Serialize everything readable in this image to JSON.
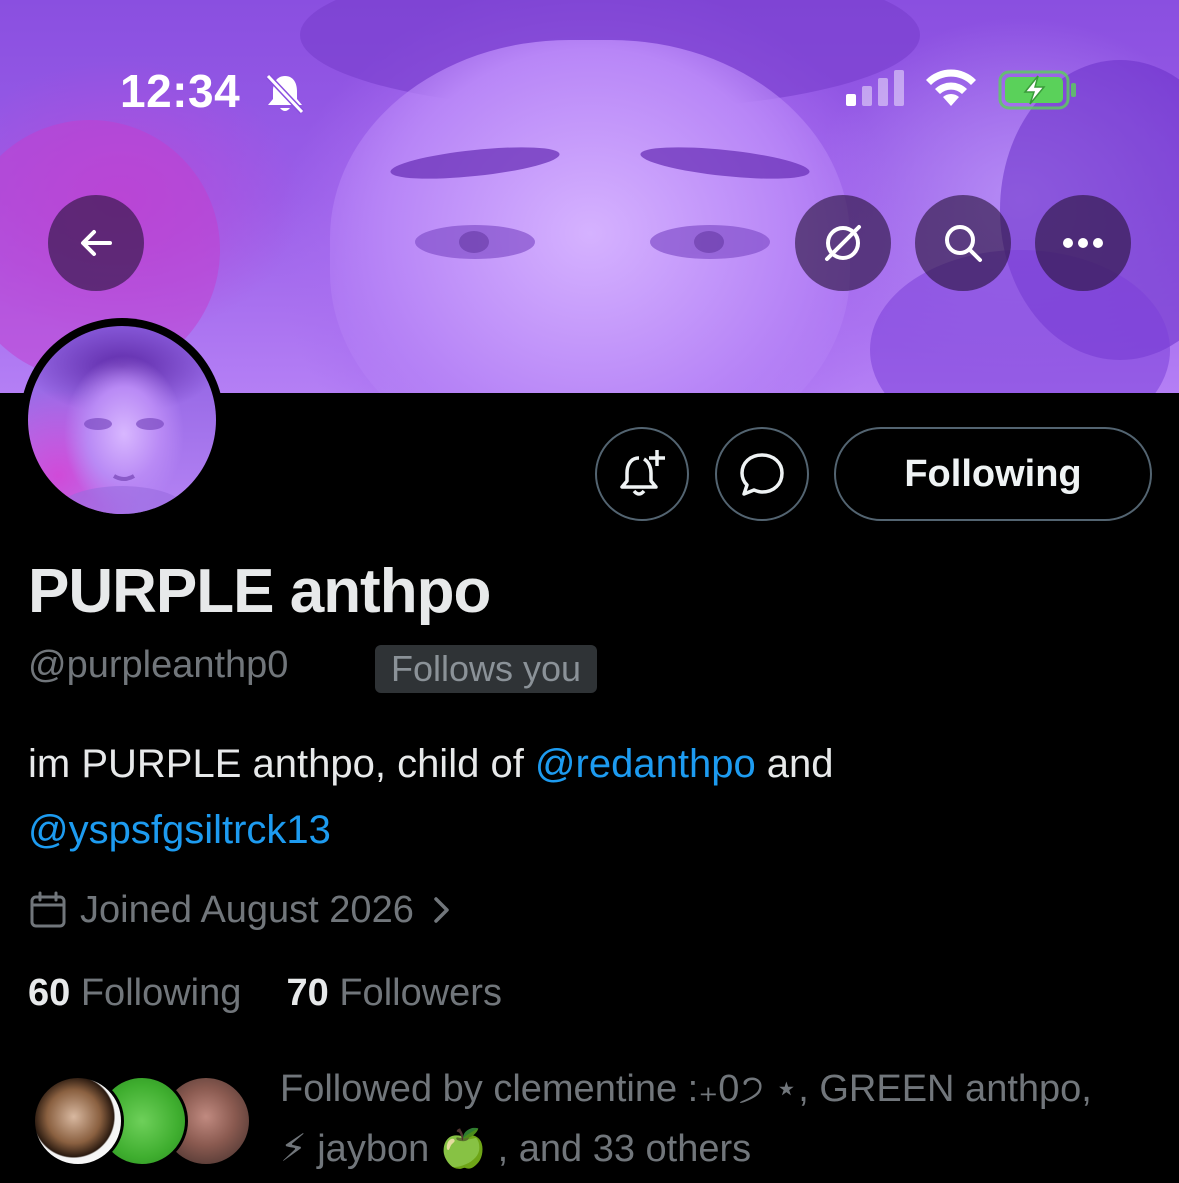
{
  "status_bar": {
    "time": "12:34"
  },
  "icons": {
    "mute": "bell-slash-icon",
    "signal": "cellular-signal-icon",
    "wifi": "wifi-icon",
    "battery": "battery-charging-icon",
    "back": "arrow-left-icon",
    "grok": "grok-icon",
    "search": "search-icon",
    "more": "more-horizontal-icon",
    "notify": "bell-plus-icon",
    "message": "message-bubble-icon",
    "calendar": "calendar-icon",
    "chevron": "chevron-right-icon"
  },
  "profile": {
    "display_name": "PURPLE anthpo",
    "handle": "@purpleanthp0",
    "follows_you": "Follows you",
    "following_button": "Following",
    "bio": {
      "prefix": "im PURPLE anthpo, child of ",
      "mention1": "@redanthpo",
      "middle": " and",
      "mention2": "@yspsfgsiltrck13"
    },
    "joined": "Joined August 2026",
    "following_count": "60",
    "following_label": "Following",
    "followers_count": "70",
    "followers_label": "Followers",
    "followed_by_line1": "Followed by clementine :₊0੭ ⋆, GREEN anthpo,",
    "followed_by_line2": "⚡ jaybon 🍏 , and 33 others"
  },
  "colors": {
    "background": "#000000",
    "mention": "#1d9bf0",
    "secondary_text": "#71767b",
    "primary_text": "#e7e9ea",
    "button_border": "#536471",
    "badge_bg": "#2f3336",
    "banner_purple": "#9a5ee8",
    "battery_green": "#5ad15a"
  }
}
